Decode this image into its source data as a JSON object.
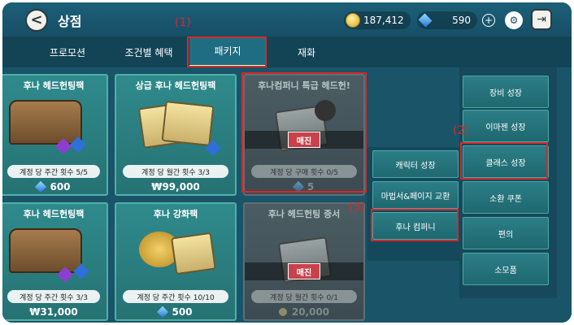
{
  "header": {
    "title": "상점",
    "back_icon": "back-arrow-icon",
    "gold": "187,412",
    "gems": "590",
    "plus": "+",
    "exit_icon": "exit-door-icon"
  },
  "tabs": [
    {
      "label": "프로모션",
      "active": false
    },
    {
      "label": "조건별 혜택",
      "active": false
    },
    {
      "label": "패키지",
      "active": true
    },
    {
      "label": "재화",
      "active": false
    }
  ],
  "annotations": [
    "(1)",
    "(2)",
    "(3)"
  ],
  "products": [
    {
      "title": "후나 헤드헌팅팩",
      "limit": "계정 당 주간 횟수 5/5",
      "price": "600",
      "currency": "gem",
      "sold_out": false
    },
    {
      "title": "상급 후나 헤드헌팅팩",
      "limit": "계정 당 월간 횟수 3/3",
      "price": "₩99,000",
      "currency": "won",
      "sold_out": false
    },
    {
      "title": "후나컴퍼니 특급 헤드헌!",
      "limit": "계정 당 구매 횟수 0/5",
      "price": "5",
      "currency": "gem",
      "sold_out": true,
      "sold_out_label": "매진"
    },
    {
      "title": "후나 헤드헌팅팩",
      "limit": "계정 당 주간 횟수 3/3",
      "price": "₩31,000",
      "currency": "won",
      "sold_out": false
    },
    {
      "title": "후나 강화팩",
      "limit": "계정 당 주간 횟수 10/10",
      "price": "500",
      "currency": "gem",
      "sold_out": false
    },
    {
      "title": "후나 헤드헌팅 증서",
      "limit": "계정 당 월간 횟수 0/1",
      "price": "20,000",
      "currency": "gold",
      "sold_out": true,
      "sold_out_label": "매진"
    }
  ],
  "middle_menu": [
    "캐릭터 성장",
    "마법서&페이지 교환",
    "후나 컴퍼니"
  ],
  "right_menu": [
    "장비 성장",
    "이마젠 성장",
    "클래스 성장",
    "소환 쿠폰",
    "편의",
    "소모품"
  ],
  "colors": {
    "annotation": "#d8282a",
    "accent": "#1f6d82"
  }
}
